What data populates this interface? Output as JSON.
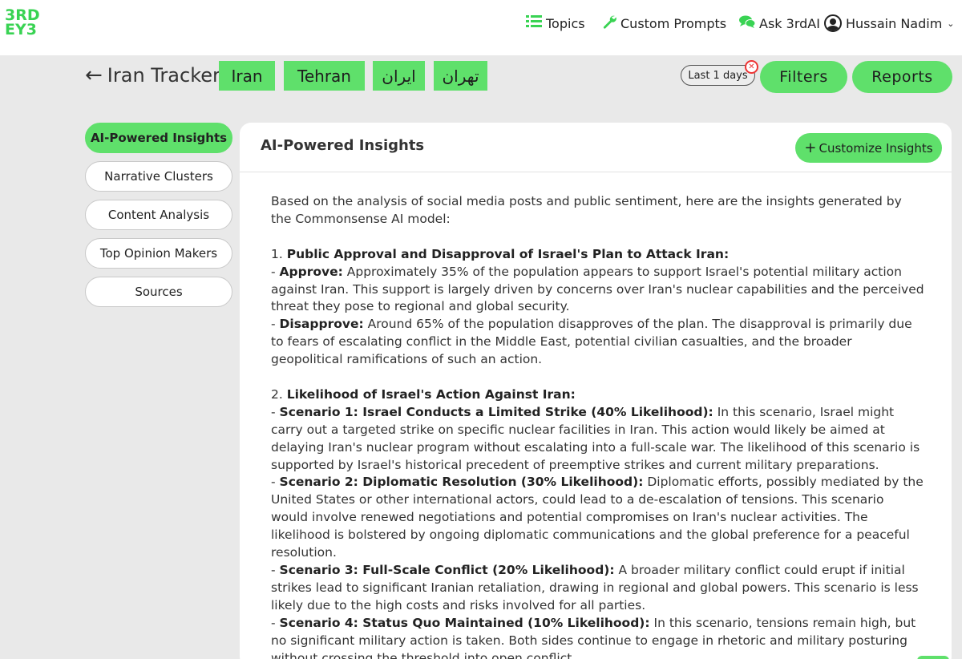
{
  "logo": {
    "line1": "3RD",
    "line2": "EY3"
  },
  "nav": {
    "topics": "Topics",
    "custom_prompts": "Custom Prompts",
    "ask": "Ask 3rdAI",
    "user": "Hussain Nadim"
  },
  "tracker": {
    "title": "Iran Tracker",
    "keywords": [
      "Iran",
      "Tehran",
      "ایران",
      "تهران"
    ],
    "time_filter": "Last 1 days",
    "filters_label": "Filters",
    "reports_label": "Reports"
  },
  "sidebar": {
    "items": [
      {
        "label": "AI-Powered Insights",
        "active": true
      },
      {
        "label": "Narrative Clusters",
        "active": false
      },
      {
        "label": "Content Analysis",
        "active": false
      },
      {
        "label": "Top Opinion Makers",
        "active": false
      },
      {
        "label": "Sources",
        "active": false
      }
    ]
  },
  "panel": {
    "title": "AI-Powered Insights",
    "customize_label": "Customize Insights",
    "intro": "Based on the analysis of social media posts and public sentiment, here are the insights generated by the Commonsense AI model:",
    "section1": {
      "heading_num": "1. ",
      "heading": "Public Approval and Disapproval of Israel's Plan to Attack Iran:",
      "items": [
        {
          "label": "Approve:",
          "text": " Approximately 35% of the population appears to support Israel's potential military action against Iran. This support is largely driven by concerns over Iran's nuclear capabilities and the perceived threat they pose to regional and global security."
        },
        {
          "label": "Disapprove:",
          "text": " Around 65% of the population disapproves of the plan. The disapproval is primarily due to fears of escalating conflict in the Middle East, potential civilian casualties, and the broader geopolitical ramifications of such an action."
        }
      ]
    },
    "section2": {
      "heading_num": "2. ",
      "heading": "Likelihood of Israel's Action Against Iran:",
      "items": [
        {
          "label": "Scenario 1: Israel Conducts a Limited Strike (40% Likelihood):",
          "text": " In this scenario, Israel might carry out a targeted strike on specific nuclear facilities in Iran. This action would likely be aimed at delaying Iran's nuclear program without escalating into a full-scale war. The likelihood of this scenario is supported by Israel's historical precedent of preemptive strikes and current military preparations."
        },
        {
          "label": "Scenario 2: Diplomatic Resolution (30% Likelihood):",
          "text": " Diplomatic efforts, possibly mediated by the United States or other international actors, could lead to a de-escalation of tensions. This scenario would involve renewed negotiations and potential compromises on Iran's nuclear activities. The likelihood is bolstered by ongoing diplomatic communications and the global preference for a peaceful resolution."
        },
        {
          "label": "Scenario 3: Full-Scale Conflict (20% Likelihood):",
          "text": " A broader military conflict could erupt if initial strikes lead to significant Iranian retaliation, drawing in regional and global powers. This scenario is less likely due to the high costs and risks involved for all parties."
        },
        {
          "label": "Scenario 4: Status Quo Maintained (10% Likelihood):",
          "text": " In this scenario, tensions remain high, but no significant military action is taken. Both sides continue to engage in rhetoric and military posturing without crossing the threshold into open conflict."
        }
      ]
    }
  },
  "colors": {
    "accent": "#5fe06b",
    "logo": "#39d353",
    "background": "#e9e9e9",
    "close": "#ee3333"
  }
}
